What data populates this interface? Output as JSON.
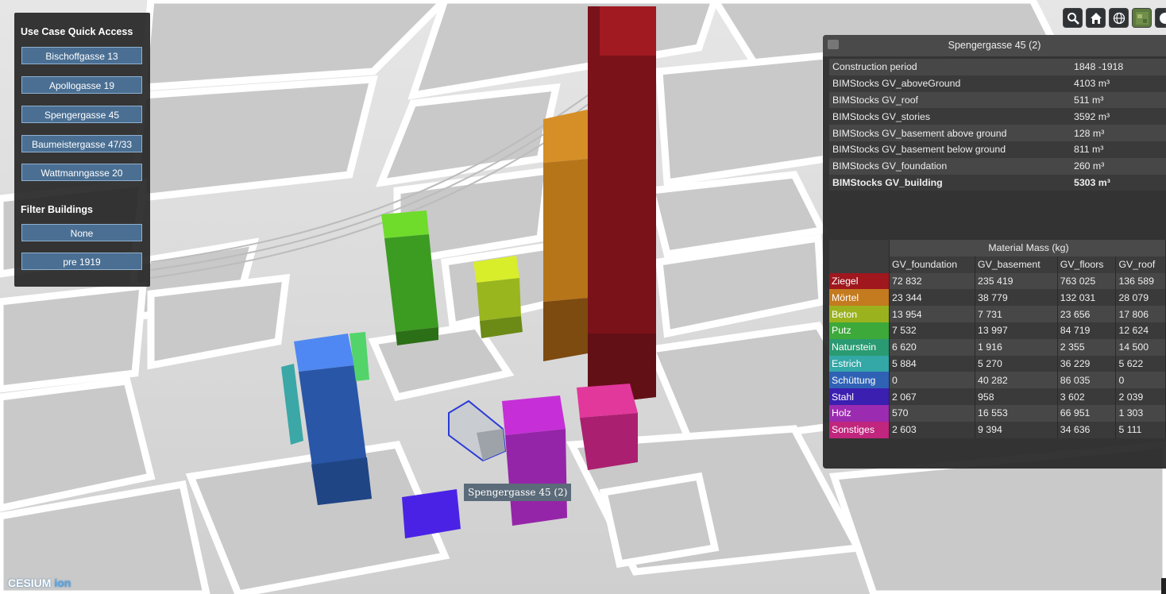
{
  "quick_access": {
    "title": "Use Case Quick Access",
    "buttons": [
      "Bischoffgasse 13",
      "Apollogasse 19",
      "Spengergasse 45",
      "Baumeistergasse 47/33",
      "Wattmanngasse 20"
    ],
    "filter_title": "Filter Buildings",
    "filter_buttons": [
      "None",
      "pre 1919"
    ]
  },
  "toolbar": {
    "icons": [
      "search-icon",
      "home-icon",
      "globe-icon",
      "layer-picker-icon",
      "help-icon"
    ]
  },
  "infobox": {
    "title": "Spengergasse 45 (2)",
    "properties": [
      {
        "label": "Construction period",
        "value": "1848 -1918"
      },
      {
        "label": "BIMStocks GV_aboveGround",
        "value": "4103 m³"
      },
      {
        "label": "BIMStocks GV_roof",
        "value": "511 m³"
      },
      {
        "label": "BIMStocks GV_stories",
        "value": "3592 m³"
      },
      {
        "label": "BIMStocks GV_basement above ground",
        "value": "128 m³"
      },
      {
        "label": "BIMStocks GV_basement below ground",
        "value": "811 m³"
      },
      {
        "label": "BIMStocks GV_foundation",
        "value": "260 m³"
      },
      {
        "label": "BIMStocks GV_building",
        "value": "5303 m³"
      }
    ],
    "material_table": {
      "title": "Material Mass (kg)",
      "columns": [
        "GV_foundation",
        "GV_basement",
        "GV_floors",
        "GV_roof"
      ],
      "rows": [
        {
          "material": "Ziegel",
          "color": "#a0171e",
          "values": [
            "72 832",
            "235 419",
            "763 025",
            "136 589"
          ]
        },
        {
          "material": "Mörtel",
          "color": "#c47a1f",
          "values": [
            "23 344",
            "38 779",
            "132 031",
            "28 079"
          ]
        },
        {
          "material": "Beton",
          "color": "#9ab21e",
          "values": [
            "13 954",
            "7 731",
            "23 656",
            "17 806"
          ]
        },
        {
          "material": "Putz",
          "color": "#3ca93a",
          "values": [
            "7 532",
            "13 997",
            "84 719",
            "12 624"
          ]
        },
        {
          "material": "Naturstein",
          "color": "#2a9a73",
          "values": [
            "6 620",
            "1 916",
            "2 355",
            "14 500"
          ]
        },
        {
          "material": "Estrich",
          "color": "#34a7a7",
          "values": [
            "5 884",
            "5 270",
            "36 229",
            "5 622"
          ]
        },
        {
          "material": "Schüttung",
          "color": "#2f62b5",
          "values": [
            "0",
            "40 282",
            "86 035",
            "0"
          ]
        },
        {
          "material": "Stahl",
          "color": "#3b1fb0",
          "values": [
            "2 067",
            "958",
            "3 602",
            "2 039"
          ]
        },
        {
          "material": "Holz",
          "color": "#9b2bb0",
          "values": [
            "570",
            "16 553",
            "66 951",
            "1 303"
          ]
        },
        {
          "material": "Sonstiges",
          "color": "#c0267d",
          "values": [
            "2 603",
            "9 394",
            "34 636",
            "5 111"
          ]
        }
      ]
    }
  },
  "tooltip": {
    "text": "Spengergasse 45 (2)"
  },
  "logo": {
    "brand": "CESIUM",
    "suffix": "ion"
  }
}
